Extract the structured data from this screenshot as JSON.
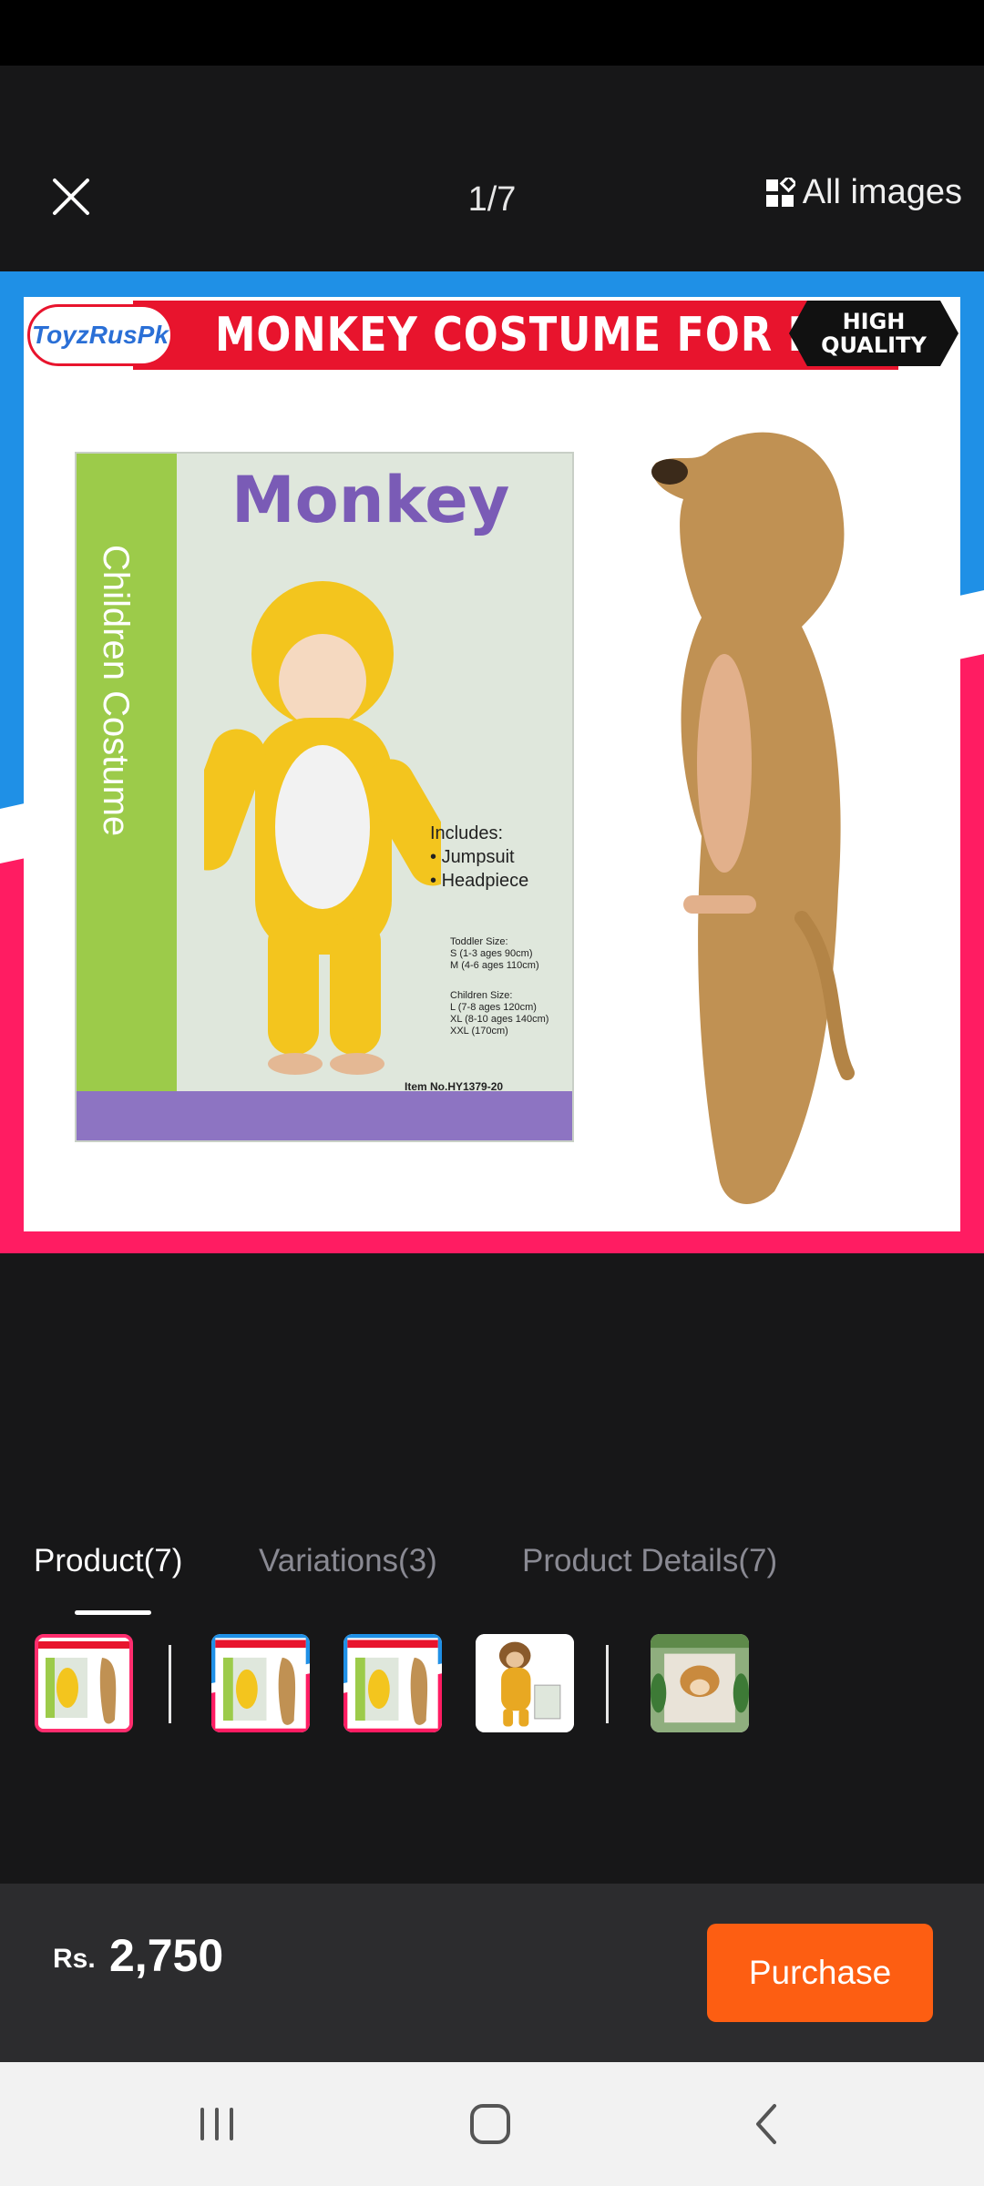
{
  "viewer": {
    "counter": "1/7",
    "all_images_label": "All images"
  },
  "hero": {
    "banner_title": "MONKEY COSTUME FOR KIDS",
    "brand_logo": "ToyzRusPk",
    "badge_line1": "HIGH",
    "badge_line2": "QUALITY",
    "package_title": "Monkey",
    "package_side_text": "Children Costume",
    "includes_title": "Includes:",
    "includes_items": [
      "Jumpsuit",
      "Headpiece"
    ],
    "size_lines": [
      "Toddler Size:",
      "S (1-3 ages 90cm)",
      "M (4-6 ages 110cm)",
      "Children Size:",
      "L (7-8 ages 120cm)",
      "XL (8-10 ages 140cm)",
      "XXL (170cm)"
    ],
    "item_no": "Item No.HY1379-20"
  },
  "tabs": [
    {
      "label": "Product(7)",
      "active": true
    },
    {
      "label": "Variations(3)",
      "active": false
    },
    {
      "label": "Product Details(7)",
      "active": false
    }
  ],
  "thumbnails": [
    {
      "name": "thumb-product-1",
      "selected": true
    },
    {
      "name": "thumb-variation-1",
      "selected": false
    },
    {
      "name": "thumb-variation-2",
      "selected": false
    },
    {
      "name": "thumb-variation-3",
      "selected": false
    },
    {
      "name": "thumb-detail-1",
      "selected": false
    }
  ],
  "price": {
    "currency": "Rs.",
    "value": "2,750"
  },
  "purchase_label": "Purchase",
  "colors": {
    "accent": "#fd5e12",
    "selected_border": "#ff2d6e",
    "background": "#171718"
  },
  "icons": [
    "close-icon",
    "grid-icon",
    "recents-icon",
    "home-icon",
    "back-icon"
  ]
}
